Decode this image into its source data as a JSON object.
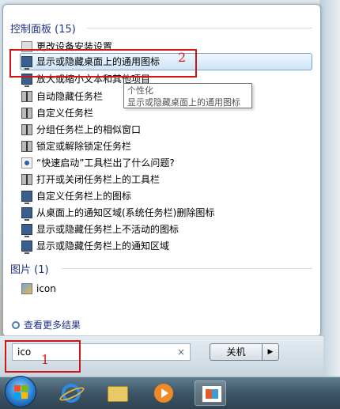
{
  "control_panel": {
    "title": "控制面板 (15)",
    "items": [
      {
        "label": "更改设备安装设置",
        "icon": "printer-icon"
      },
      {
        "label": "显示或隐藏桌面上的通用图标",
        "icon": "monitor-icon"
      },
      {
        "label": "放大或缩小文本和其他项目",
        "icon": "monitor-icon"
      },
      {
        "label": "自动隐藏任务栏",
        "icon": "taskbar-icon"
      },
      {
        "label": "自定义任务栏",
        "icon": "taskbar-icon"
      },
      {
        "label": "分组任务栏上的相似窗口",
        "icon": "taskbar-icon"
      },
      {
        "label": "锁定或解除锁定任务栏",
        "icon": "taskbar-icon"
      },
      {
        "label": "“快速启动”工具栏出了什么问题?",
        "icon": "help-icon"
      },
      {
        "label": "打开或关闭任务栏上的工具栏",
        "icon": "taskbar-icon"
      },
      {
        "label": "自定义任务栏上的图标",
        "icon": "monitor-icon"
      },
      {
        "label": "从桌面上的通知区域(系统任务栏)删除图标",
        "icon": "monitor-icon"
      },
      {
        "label": "显示或隐藏任务栏上不活动的图标",
        "icon": "monitor-icon"
      },
      {
        "label": "显示或隐藏任务栏上的通知区域",
        "icon": "monitor-icon"
      }
    ]
  },
  "pictures": {
    "title": "图片 (1)",
    "items": [
      {
        "label": "icon",
        "icon": "image-icon"
      }
    ]
  },
  "tooltip": {
    "line1": "个性化",
    "line2": "显示或隐藏桌面上的通用图标"
  },
  "see_more": "查看更多结果",
  "search": {
    "value": "ico",
    "clear_glyph": "×"
  },
  "shutdown": {
    "label": "关机",
    "arrow": "▶"
  },
  "annotations": {
    "one": "1",
    "two": "2"
  },
  "colors": {
    "group_title": "#1e3287",
    "annotation": "#d01616"
  }
}
